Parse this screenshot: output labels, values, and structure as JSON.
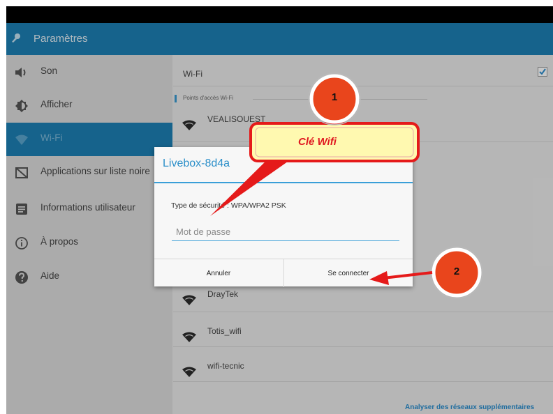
{
  "actionbar": {
    "title": "Paramètres"
  },
  "sidebar": {
    "items": [
      {
        "label": "Son",
        "icon": "volume-icon"
      },
      {
        "label": "Afficher",
        "icon": "brightness-icon"
      },
      {
        "label": "Wi-Fi",
        "icon": "wifi-icon",
        "selected": true
      },
      {
        "label": "Applications sur liste noire",
        "icon": "blacklist-icon"
      },
      {
        "label": "Informations utilisateur",
        "icon": "user-info-icon"
      },
      {
        "label": "À propos",
        "icon": "info-icon"
      },
      {
        "label": "Aide",
        "icon": "help-icon"
      }
    ]
  },
  "wifi": {
    "toggle_label": "Wi-Fi",
    "enabled": true,
    "section_header": "Points d'accès Wi-Fi",
    "networks": [
      "VEALISOUEST",
      "DrayTek",
      "Totis_wifi",
      "wifi-tecnic"
    ],
    "scan_more": "Analyser des réseaux supplémentaires"
  },
  "dialog": {
    "title": "Livebox-8d4a",
    "security_label": "Type de sécurité :",
    "security_value": "WPA/WPA2 PSK",
    "password_placeholder": "Mot de passe",
    "cancel_label": "Annuler",
    "connect_label": "Se connecter"
  },
  "annotations": {
    "badge1": "1",
    "badge2": "2",
    "callout": "Clé Wifi",
    "colors": {
      "arrow": "#e31c1c",
      "callout_fill": "#fff9b0",
      "badge_fill": "#e9451c"
    }
  }
}
